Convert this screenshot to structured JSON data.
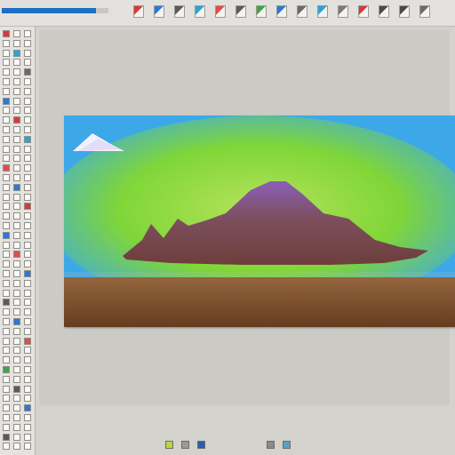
{
  "toolbar": {
    "progress_fraction": 0.88,
    "accent_color": "#1c6fc4",
    "tools": [
      {
        "icon": "pointer-icon",
        "color": "#d63a3a"
      },
      {
        "icon": "move-icon",
        "color": "#2b78d6"
      },
      {
        "icon": "select-icon",
        "color": "#5a5a5a"
      },
      {
        "icon": "crop-icon",
        "color": "#2aa4d6"
      },
      {
        "icon": "brush-icon",
        "color": "#e34b4b"
      },
      {
        "icon": "eraser-icon",
        "color": "#5b5b5b"
      },
      {
        "icon": "fill-icon",
        "color": "#3fa54a"
      },
      {
        "icon": "text-icon",
        "color": "#2b78d6"
      },
      {
        "icon": "shape-icon",
        "color": "#6a6a6a"
      },
      {
        "icon": "zoom-icon",
        "color": "#2aa4d6"
      },
      {
        "icon": "hand-icon",
        "color": "#7a7a7a"
      },
      {
        "icon": "layers-icon",
        "color": "#d63a3a"
      },
      {
        "icon": "undo-icon",
        "color": "#4a4a4a"
      },
      {
        "icon": "redo-icon",
        "color": "#4a4a4a"
      },
      {
        "icon": "settings-icon",
        "color": "#6a6a6a"
      }
    ]
  },
  "left_panel": {
    "tool_colors": [
      "#d63a3a",
      "#2b78d6",
      "#5a5a5a",
      "#2aa4d6",
      "#e34b4b",
      "#3fa54a",
      "#6a6a6a",
      "#2b78d6",
      "#5b5b5b",
      "#7a7a7a"
    ]
  },
  "canvas": {
    "sky_color": "#3da8e8",
    "glow_color": "#8ed93a",
    "mountain_color": "#7a4c57",
    "peak_color": "#8b5fb8",
    "ground_color": "#8a5a36",
    "cloud_color": "#f3f1ff"
  },
  "status": {
    "icons": [
      {
        "icon": "layer-visible-icon",
        "color": "#b7d64a"
      },
      {
        "icon": "lock-icon",
        "color": "#9a9a9a"
      },
      {
        "icon": "channel-icon",
        "color": "#2b5fa8"
      },
      {
        "icon": "grid-icon",
        "color": "#8a8a8a"
      },
      {
        "icon": "link-icon",
        "color": "#5aa0c8"
      }
    ]
  }
}
